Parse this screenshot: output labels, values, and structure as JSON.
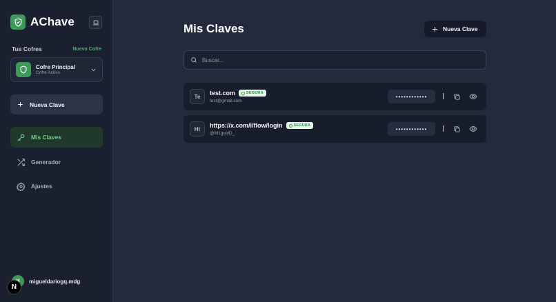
{
  "app": {
    "name": "AChave"
  },
  "sidebar": {
    "vaults_title": "Tus Cofres",
    "new_vault": "Nuevo Cofre",
    "vault": {
      "name": "Cofre Principal",
      "status": "Cofre Activo"
    },
    "new_key": "Nueva Clave",
    "nav": [
      {
        "label": "Mis Claves",
        "icon": "key-icon",
        "active": true
      },
      {
        "label": "Generador",
        "icon": "shuffle-icon",
        "active": false
      },
      {
        "label": "Ajustes",
        "icon": "gear-icon",
        "active": false
      }
    ],
    "user": {
      "initials": "M",
      "name": "migueldariogq.mdg"
    },
    "next_badge": "N"
  },
  "main": {
    "title": "Mis Claves",
    "new_key": "Nueva Clave",
    "search": {
      "placeholder": "Buscar...",
      "value": ""
    },
    "entries": [
      {
        "initials": "Te",
        "title": "test.com",
        "badge": "SEGURA",
        "subtitle": "test@gmail.com",
        "password_mask": "••••••••••••",
        "divider": "|"
      },
      {
        "initials": "Ht",
        "title": "https://x.com/i/flow/login",
        "badge": "SEGURA",
        "subtitle": "@M1guelD_",
        "password_mask": "••••••••••••",
        "divider": "|"
      }
    ]
  },
  "colors": {
    "accent": "#3d9a58",
    "accent_text": "#6fcf86",
    "background": "#232a3b",
    "sidebar": "#1a2030"
  }
}
